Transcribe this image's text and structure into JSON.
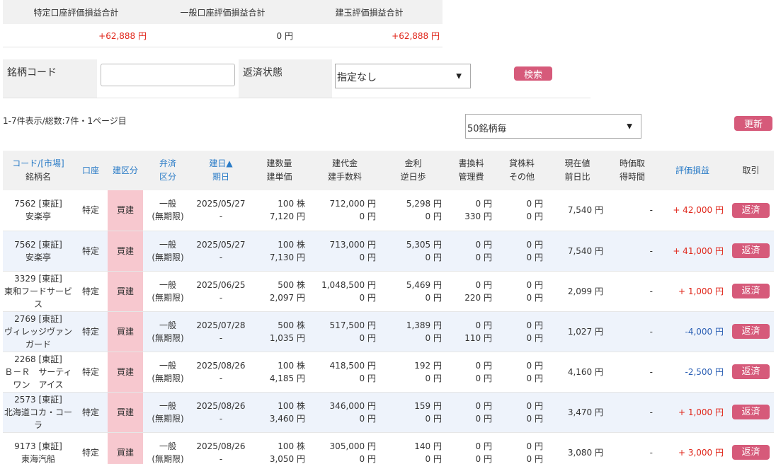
{
  "summary": {
    "headers": [
      "特定口座評価損益合計",
      "一般口座評価損益合計",
      "建玉評価損益合計"
    ],
    "values": [
      "+62,888 円",
      "0 円",
      "+62,888 円"
    ]
  },
  "search": {
    "code_label": "銘柄コード",
    "code_value": "",
    "status_label": "返済状態",
    "status_value": "指定なし",
    "search_button": "検索"
  },
  "list": {
    "count_text": "1-7件表示/総数:7件・1ページ目",
    "per_page": "50銘柄毎",
    "refresh_button": "更新"
  },
  "table": {
    "headers": {
      "code_a": "コード/",
      "code_b": "[市場]",
      "code_c": "銘柄名",
      "account": "口座",
      "type": "建区分",
      "repay_a": "弁済",
      "repay_b": "区分",
      "date_a": "建日▲",
      "date_b": "期日",
      "qty_a": "建数量",
      "qty_b": "建単価",
      "amt_a": "建代金",
      "amt_b": "建手数料",
      "int_a": "金利",
      "int_b": "逆日歩",
      "fee_a": "書換料",
      "fee_b": "管理費",
      "lend_a": "貸株料",
      "lend_b": "その他",
      "price_a": "現在値",
      "price_b": "前日比",
      "time_a": "時価取",
      "time_b": "得時間",
      "pl": "評価損益",
      "trade": "取引"
    },
    "rows": [
      {
        "code": "7562 [東証]",
        "name": "安楽亭",
        "account": "特定",
        "type": "買建",
        "repay": "一般",
        "repay_sub": "(無期限)",
        "date": "2025/05/27",
        "due": "-",
        "qty": "100 株",
        "unit": "7,120 円",
        "amount": "712,000 円",
        "fee": "0 円",
        "interest": "5,298 円",
        "gyaku": "0 円",
        "kakikae": "0 円",
        "kanri": "330 円",
        "kashikabu": "0 円",
        "other": "0 円",
        "price": "7,540 円",
        "time": "-",
        "pl": "+ 42,000 円",
        "pl_sign": "pos",
        "action": "返済"
      },
      {
        "code": "7562 [東証]",
        "name": "安楽亭",
        "account": "特定",
        "type": "買建",
        "repay": "一般",
        "repay_sub": "(無期限)",
        "date": "2025/05/27",
        "due": "-",
        "qty": "100 株",
        "unit": "7,130 円",
        "amount": "713,000 円",
        "fee": "0 円",
        "interest": "5,305 円",
        "gyaku": "0 円",
        "kakikae": "0 円",
        "kanri": "0 円",
        "kashikabu": "0 円",
        "other": "0 円",
        "price": "7,540 円",
        "time": "-",
        "pl": "+ 41,000 円",
        "pl_sign": "pos",
        "action": "返済"
      },
      {
        "code": "3329 [東証]",
        "name": "東和フードサービス",
        "account": "特定",
        "type": "買建",
        "repay": "一般",
        "repay_sub": "(無期限)",
        "date": "2025/06/25",
        "due": "-",
        "qty": "500 株",
        "unit": "2,097 円",
        "amount": "1,048,500 円",
        "fee": "0 円",
        "interest": "5,469 円",
        "gyaku": "0 円",
        "kakikae": "0 円",
        "kanri": "220 円",
        "kashikabu": "0 円",
        "other": "0 円",
        "price": "2,099 円",
        "time": "-",
        "pl": "+ 1,000 円",
        "pl_sign": "pos",
        "action": "返済"
      },
      {
        "code": "2769 [東証]",
        "name": "ヴィレッジヴァンガード",
        "account": "特定",
        "type": "買建",
        "repay": "一般",
        "repay_sub": "(無期限)",
        "date": "2025/07/28",
        "due": "-",
        "qty": "500 株",
        "unit": "1,035 円",
        "amount": "517,500 円",
        "fee": "0 円",
        "interest": "1,389 円",
        "gyaku": "0 円",
        "kakikae": "0 円",
        "kanri": "110 円",
        "kashikabu": "0 円",
        "other": "0 円",
        "price": "1,027 円",
        "time": "-",
        "pl": "-4,000 円",
        "pl_sign": "neg",
        "action": "返済"
      },
      {
        "code": "2268 [東証]",
        "name": "Ｂ－Ｒ　サーティワン　アイス",
        "account": "特定",
        "type": "買建",
        "repay": "一般",
        "repay_sub": "(無期限)",
        "date": "2025/08/26",
        "due": "-",
        "qty": "100 株",
        "unit": "4,185 円",
        "amount": "418,500 円",
        "fee": "0 円",
        "interest": "192 円",
        "gyaku": "0 円",
        "kakikae": "0 円",
        "kanri": "0 円",
        "kashikabu": "0 円",
        "other": "0 円",
        "price": "4,160 円",
        "time": "-",
        "pl": "-2,500 円",
        "pl_sign": "neg",
        "action": "返済"
      },
      {
        "code": "2573 [東証]",
        "name": "北海道コカ・コーラ",
        "account": "特定",
        "type": "買建",
        "repay": "一般",
        "repay_sub": "(無期限)",
        "date": "2025/08/26",
        "due": "-",
        "qty": "100 株",
        "unit": "3,460 円",
        "amount": "346,000 円",
        "fee": "0 円",
        "interest": "159 円",
        "gyaku": "0 円",
        "kakikae": "0 円",
        "kanri": "0 円",
        "kashikabu": "0 円",
        "other": "0 円",
        "price": "3,470 円",
        "time": "-",
        "pl": "+ 1,000 円",
        "pl_sign": "pos",
        "action": "返済"
      },
      {
        "code": "9173 [東証]",
        "name": "東海汽船",
        "account": "特定",
        "type": "買建",
        "repay": "一般",
        "repay_sub": "(無期限)",
        "date": "2025/08/26",
        "due": "-",
        "qty": "100 株",
        "unit": "3,050 円",
        "amount": "305,000 円",
        "fee": "0 円",
        "interest": "140 円",
        "gyaku": "0 円",
        "kakikae": "0 円",
        "kanri": "0 円",
        "kashikabu": "0 円",
        "other": "0 円",
        "price": "3,080 円",
        "time": "-",
        "pl": "+ 3,000 円",
        "pl_sign": "pos",
        "action": "返済"
      }
    ]
  },
  "colors": {
    "positive": "#e0261a",
    "negative": "#2b5fb4",
    "button": "#d65a7a",
    "buy_cell": "#f7c8cf",
    "link": "#2b7cc7"
  },
  "icons": {
    "dropdown": "chevron-down-icon"
  }
}
